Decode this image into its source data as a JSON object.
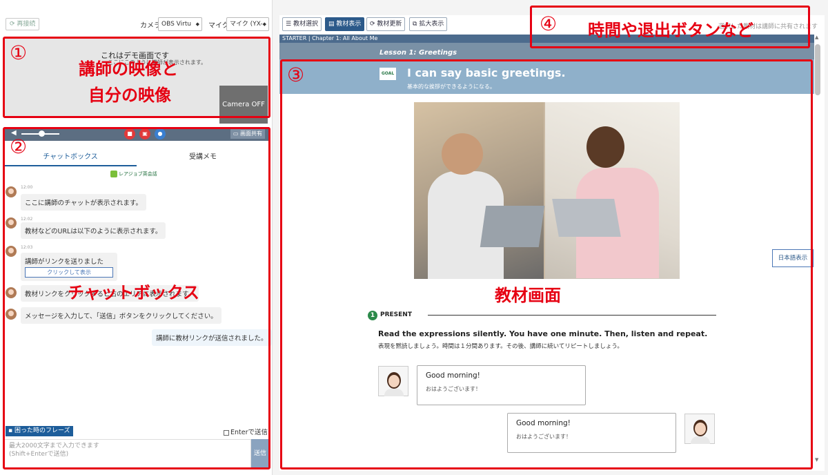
{
  "left": {
    "reconnect_label": "再接続",
    "camera_label": "カメラ",
    "camera_value": "OBS Virtu",
    "mic_label": "マイク",
    "mic_value": "マイク (YX-",
    "video_demo_text": "これはデモ画面です",
    "video_demo_sub": "ここにこのように講師が表示されます。",
    "camera_off_label": "Camera OFF",
    "share_label": "画面共有",
    "tabs": [
      "チャットボックス",
      "受講メモ"
    ],
    "logo_text": "レアジョブ英会話",
    "messages": [
      {
        "time": "12:00",
        "text": "ここに講師のチャットが表示されます。"
      },
      {
        "time": "12:02",
        "text": "教材などのURLは以下のように表示されます。"
      },
      {
        "time": "12:03",
        "text": "講師がリンクを送りました",
        "button": "クリックして表示"
      },
      {
        "time": "",
        "text": "教材リンクをクリックすると右のエリアに表示されます。"
      },
      {
        "time": "",
        "text": "メッセージを入力して、「送信」ボタンをクリックしてください。"
      }
    ],
    "my_message": "講師に教材リンクが送信されました。",
    "phrase_button": "困った時のフレーズ",
    "enter_send_label": "Enterで送信",
    "input_placeholder_1": "最大2000文字まで入力できます",
    "input_placeholder_2": "(Shift+Enterで送信)",
    "send_label": "送信"
  },
  "right": {
    "toolbar": {
      "select_material": "教材選択",
      "show_material": "教材表示",
      "update_material": "教材更新",
      "zoom": "拡大表示",
      "note": "選択した教材は講師に共有されます"
    },
    "lesson_header": "STARTER | Chapter 1: All About Me",
    "lesson_title": "Lesson 1: Greetings",
    "goal_badge": "GOAL",
    "goal_title": "I can say basic greetings.",
    "goal_sub": "基本的な挨拶ができるようになる。",
    "present_num": "1",
    "present_label": "PRESENT",
    "instruction_en": "Read the expressions silently. You have one minute. Then, listen and repeat.",
    "instruction_ja": "表現を黙読しましょう。時間は１分間あります。その後、講師に続いてリピートしましょう。",
    "dialogues": [
      {
        "en": "Good morning!",
        "ja": "おはようございます！"
      },
      {
        "en": "Good morning!",
        "ja": "おはようございます！"
      }
    ],
    "jp_toggle": "日本語表示"
  },
  "annotations": {
    "n1": "①",
    "t1a": "講師の映像と",
    "t1b": "自分の映像",
    "n2": "②",
    "t2": "チャットボックス",
    "n3": "③",
    "t3": "教材画面",
    "n4": "④",
    "t4": "時間や退出ボタンなど"
  }
}
